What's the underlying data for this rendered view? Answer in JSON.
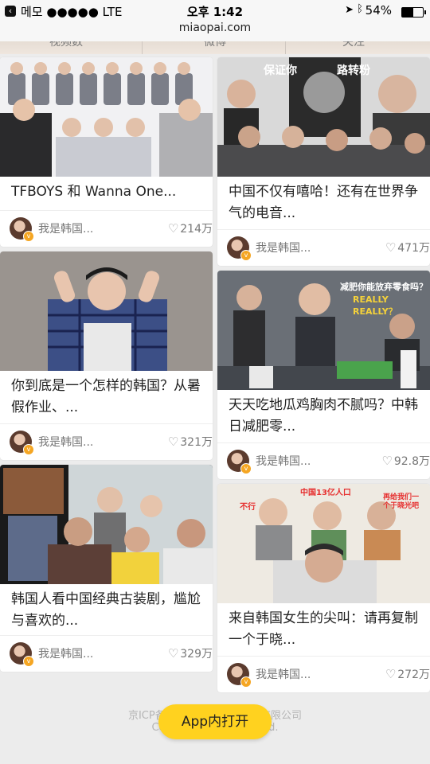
{
  "status_bar": {
    "carrier": "메모 ●●●●● LTE",
    "time": "오후 1:42",
    "battery": "54%",
    "battery_level": 0.54,
    "url": "miaopai.com"
  },
  "tabs": [
    "视频数",
    "微博",
    "关注"
  ],
  "cards_left": [
    {
      "title": "TFBOYS 和 Wanna One...",
      "author": "我是韩国...",
      "likes": "214万"
    },
    {
      "title": "你到底是一个怎样的韩国？从暑假作业、...",
      "author": "我是韩国...",
      "likes": "321万"
    },
    {
      "title": "韩国人看中国经典古装剧，尴尬与喜欢的...",
      "author": "我是韩国...",
      "likes": "329万"
    }
  ],
  "cards_right": [
    {
      "title": "中国不仅有嘻哈！还有在世界争气的电音...",
      "author": "我是韩国...",
      "likes": "471万",
      "overlay": [
        "保证你",
        "路转粉"
      ]
    },
    {
      "title": "天天吃地瓜鸡胸肉不腻吗？中韩日减肥零...",
      "author": "我是韩国...",
      "likes": "92.8万",
      "overlay": [
        "减肥你能放弃零食吗？",
        "REALLY REALLY？"
      ]
    },
    {
      "title": "来自韩国女生的尖叫：请再复制一个于晓...",
      "author": "我是韩国...",
      "likes": "272万",
      "overlay": [
        "中国13亿人口",
        "不行",
        "再给我们一个于晓光吧"
      ]
    }
  ],
  "footer": {
    "icp": "京ICP备12022…（…）科技有限公司",
    "copyright": "Copyright …… reserved.",
    "app_button": "App内打开"
  }
}
